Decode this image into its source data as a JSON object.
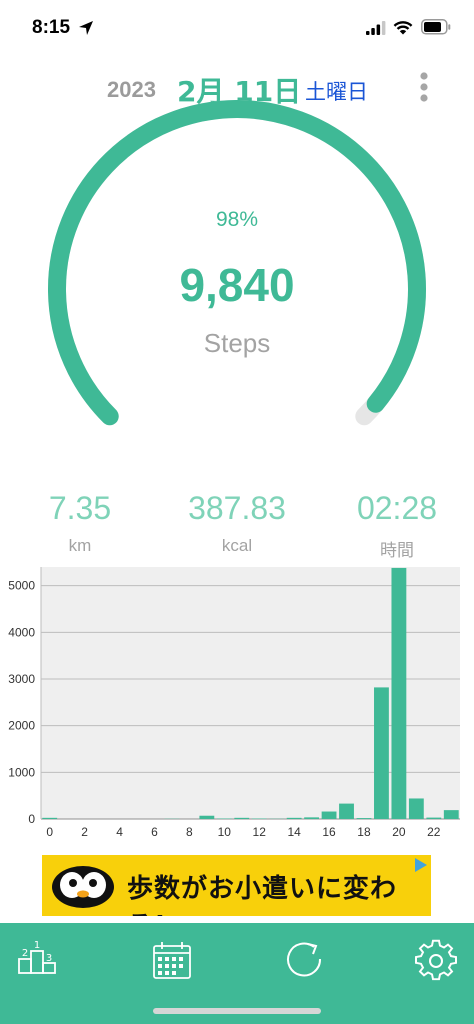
{
  "status_bar": {
    "time": "8:15"
  },
  "date": {
    "year": "2023",
    "month_day": "2月 11日",
    "day_of_week": "土曜日"
  },
  "gauge": {
    "percent": "98%",
    "steps": "9,840",
    "unit": "Steps",
    "fraction": 0.98
  },
  "stats": [
    {
      "value": "7.35",
      "label": "km"
    },
    {
      "value": "387.83",
      "label": "kcal"
    },
    {
      "value": "02:28",
      "label": "時間"
    }
  ],
  "chart_data": {
    "type": "bar",
    "x": [
      0,
      1,
      2,
      3,
      4,
      5,
      6,
      7,
      8,
      9,
      10,
      11,
      12,
      13,
      14,
      15,
      16,
      17,
      18,
      19,
      20,
      21,
      22,
      23
    ],
    "values": [
      25,
      0,
      0,
      0,
      0,
      0,
      0,
      5,
      0,
      70,
      10,
      25,
      10,
      5,
      25,
      35,
      160,
      330,
      20,
      2820,
      5380,
      440,
      30,
      190
    ],
    "x_tick_labels": [
      "0",
      "2",
      "4",
      "6",
      "8",
      "10",
      "12",
      "14",
      "16",
      "18",
      "20",
      "22"
    ],
    "y_tick_labels": [
      "0",
      "1000",
      "2000",
      "3000",
      "4000",
      "5000"
    ],
    "ylim": [
      0,
      5400
    ],
    "grid": true,
    "bar_color": "#3fb996",
    "plot_background": "#efefef"
  },
  "ad": {
    "text": "歩数がお小遣いに変わる!"
  },
  "tabs": [
    {
      "name": "ranking-icon"
    },
    {
      "name": "calendar-icon"
    },
    {
      "name": "refresh-icon"
    },
    {
      "name": "settings-icon"
    }
  ],
  "colors": {
    "accent": "#3fb996",
    "accent_light": "#7fd3b8",
    "weekday_blue": "#1a55d6",
    "gray": "#a3a3a3"
  }
}
